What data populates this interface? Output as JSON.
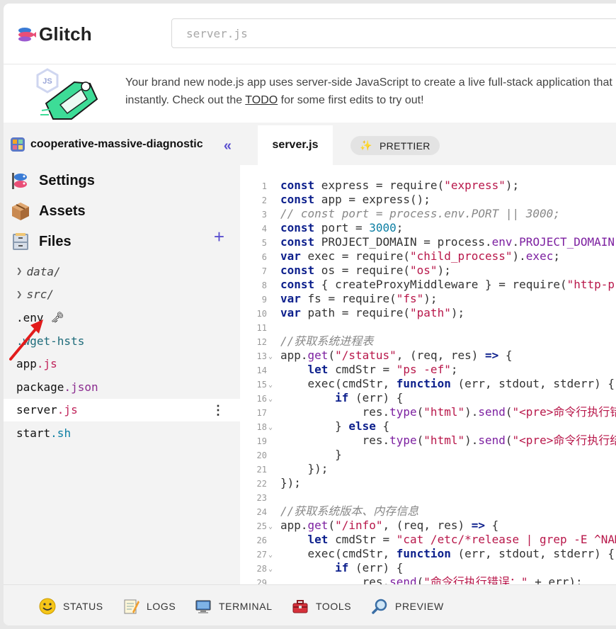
{
  "header": {
    "logo_text": "Glitch",
    "search_placeholder": "server.js"
  },
  "banner": {
    "line1": "Your brand new node.js app uses server-side JavaScript to create a live full-stack application that",
    "line2_prefix": "instantly. Check out the ",
    "todo_link": "TODO",
    "line2_suffix": " for some first edits to try out!",
    "art_badge": "JS"
  },
  "sidebar": {
    "project_name": "cooperative-massive-diagnostic",
    "collapse_label": "«",
    "nav": [
      {
        "label": "Settings",
        "icon": "fish-flag-icon"
      },
      {
        "label": "Assets",
        "icon": "box-icon"
      },
      {
        "label": "Files",
        "icon": "file-cabinet-icon"
      }
    ],
    "add_label": "+",
    "files": [
      {
        "name": "data/",
        "type": "folder"
      },
      {
        "name": "src/",
        "type": "folder"
      },
      {
        "name": ".env",
        "type": "env",
        "key": "🗝"
      },
      {
        "base": ".wget-hsts",
        "type": "file"
      },
      {
        "base": "app",
        "ext": ".js"
      },
      {
        "base": "package",
        "ext": ".json"
      },
      {
        "base": "server",
        "ext": ".js",
        "menu": "⋮"
      },
      {
        "base": "start",
        "ext": ".sh"
      }
    ]
  },
  "editor": {
    "tab_label": "server.js",
    "prettier_label": "PRETTIER",
    "lines": [
      {
        "n": "1",
        "html": "<span class='kw'>const</span> express = require(<span class='str'>\"express\"</span>);"
      },
      {
        "n": "2",
        "html": "<span class='kw'>const</span> app = express();"
      },
      {
        "n": "3",
        "html": "<span class='cm'>// const port = process.env.PORT || 3000;</span>"
      },
      {
        "n": "4",
        "html": "<span class='kw'>const</span> port = <span class='num'>3000</span>;"
      },
      {
        "n": "5",
        "html": "<span class='kw'>const</span> PROJECT_DOMAIN = process.<span class='fn'>env</span>.<span class='fn'>PROJECT_DOMAIN</span>;"
      },
      {
        "n": "6",
        "html": "<span class='kw'>var</span> exec = require(<span class='str'>\"child_process\"</span>).<span class='fn'>exec</span>;"
      },
      {
        "n": "7",
        "html": "<span class='kw'>const</span> os = require(<span class='str'>\"os\"</span>);"
      },
      {
        "n": "8",
        "html": "<span class='kw'>const</span> { createProxyMiddleware } = require(<span class='str'>\"http-proxy-middleware\"</span>);"
      },
      {
        "n": "9",
        "html": "<span class='kw'>var</span> fs = require(<span class='str'>\"fs\"</span>);"
      },
      {
        "n": "10",
        "html": "<span class='kw'>var</span> path = require(<span class='str'>\"path\"</span>);"
      },
      {
        "n": "11",
        "html": ""
      },
      {
        "n": "12",
        "html": "<span class='cm'>//获取系统进程表</span>"
      },
      {
        "n": "13",
        "fold": true,
        "html": "app.<span class='fn'>get</span>(<span class='str'>\"/status\"</span>, (req, res) <span class='kw'>=&gt;</span> {"
      },
      {
        "n": "14",
        "html": "    <span class='kw'>let</span> cmdStr = <span class='str'>\"ps -ef\"</span>;"
      },
      {
        "n": "15",
        "fold": true,
        "html": "    exec(cmdStr, <span class='kw'>function</span> (err, stdout, stderr) {"
      },
      {
        "n": "16",
        "fold": true,
        "html": "        <span class='kw'>if</span> (err) {"
      },
      {
        "n": "17",
        "html": "            res.<span class='fn'>type</span>(<span class='str'>\"html\"</span>).<span class='fn'>send</span>(<span class='str'>\"&lt;pre&gt;命令行执行错误</span>"
      },
      {
        "n": "18",
        "fold": true,
        "html": "        } <span class='kw'>else</span> {"
      },
      {
        "n": "19",
        "html": "            res.<span class='fn'>type</span>(<span class='str'>\"html\"</span>).<span class='fn'>send</span>(<span class='str'>\"&lt;pre&gt;命令行执行结果</span>"
      },
      {
        "n": "20",
        "html": "        }"
      },
      {
        "n": "21",
        "html": "    });"
      },
      {
        "n": "22",
        "html": "});"
      },
      {
        "n": "23",
        "html": ""
      },
      {
        "n": "24",
        "html": "<span class='cm'>//获取系统版本、内存信息</span>"
      },
      {
        "n": "25",
        "fold": true,
        "html": "app.<span class='fn'>get</span>(<span class='str'>\"/info\"</span>, (req, res) <span class='kw'>=&gt;</span> {"
      },
      {
        "n": "26",
        "html": "    <span class='kw'>let</span> cmdStr = <span class='str'>\"cat /etc/*release | grep -E ^NAME\"</span>;"
      },
      {
        "n": "27",
        "fold": true,
        "html": "    exec(cmdStr, <span class='kw'>function</span> (err, stdout, stderr) {"
      },
      {
        "n": "28",
        "fold": true,
        "html": "        <span class='kw'>if</span> (err) {"
      },
      {
        "n": "29",
        "html": "            res.<span class='fn'>send</span>(<span class='str'>\"命令行执行错误：\"</span> + err);"
      }
    ]
  },
  "bottombar": {
    "items": [
      {
        "label": "STATUS",
        "icon": "smiley-icon"
      },
      {
        "label": "LOGS",
        "icon": "notepad-icon"
      },
      {
        "label": "TERMINAL",
        "icon": "monitor-icon"
      },
      {
        "label": "TOOLS",
        "icon": "toolbox-icon"
      },
      {
        "label": "PREVIEW",
        "icon": "magnifier-icon"
      }
    ]
  },
  "colors": {
    "accent": "#5a4fcf",
    "keyword": "#0c1f8c",
    "string": "#b8174a",
    "annotation_arrow": "#e21b1b"
  }
}
